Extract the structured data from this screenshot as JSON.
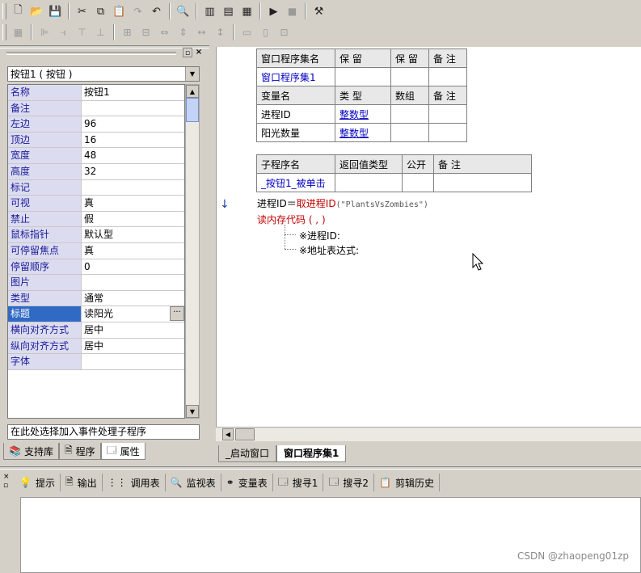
{
  "toolbar1": {
    "icons": [
      "new-file-icon",
      "open-folder-icon",
      "save-icon",
      "cut-icon",
      "copy-icon",
      "paste-icon",
      "redo-icon",
      "undo-icon",
      "find-icon",
      "layout1-icon",
      "layout2-icon",
      "layout3-icon",
      "run-icon",
      "stop-icon",
      "compile-icon"
    ]
  },
  "left_panel": {
    "selected_object": "按钮1 ( 按钮 )",
    "properties": [
      {
        "name": "名称",
        "value": "按钮1"
      },
      {
        "name": "备注",
        "value": ""
      },
      {
        "name": "左边",
        "value": "96"
      },
      {
        "name": "顶边",
        "value": "16"
      },
      {
        "name": "宽度",
        "value": "48"
      },
      {
        "name": "高度",
        "value": "32"
      },
      {
        "name": "标记",
        "value": ""
      },
      {
        "name": "可视",
        "value": "真"
      },
      {
        "name": "禁止",
        "value": "假"
      },
      {
        "name": "鼠标指针",
        "value": "默认型"
      },
      {
        "name": "可停留焦点",
        "value": "真"
      },
      {
        "name": "  停留顺序",
        "value": "0"
      },
      {
        "name": "图片",
        "value": ""
      },
      {
        "name": "类型",
        "value": "通常"
      },
      {
        "name": "标题",
        "value": "读阳光"
      },
      {
        "name": "横向对齐方式",
        "value": "居中"
      },
      {
        "name": "纵向对齐方式",
        "value": "居中"
      },
      {
        "name": "字体",
        "value": ""
      }
    ],
    "ellipsis_label": "···",
    "event_combo": "在此处选择加入事件处理子程序",
    "tabs": [
      "支持库",
      "程序",
      "属性"
    ]
  },
  "editor": {
    "table1": {
      "hdr": [
        "窗口程序集名",
        "保 留",
        "保 留",
        "备 注"
      ],
      "row": [
        "窗口程序集1",
        "",
        "",
        ""
      ],
      "vhdr": [
        "变量名",
        "类 型",
        "数组",
        "备 注"
      ],
      "vars": [
        [
          "进程ID",
          "整数型",
          "",
          ""
        ],
        [
          "阳光数量",
          "整数型",
          "",
          ""
        ]
      ]
    },
    "table2": {
      "hdr": [
        "子程序名",
        "返回值类型",
        "公开",
        "备 注"
      ],
      "row": [
        "_按钮1_被单击",
        "",
        "",
        ""
      ]
    },
    "code1_lhs": "进程ID＝",
    "code1_fn": "取进程ID",
    "code1_arg": "(\"PlantsVsZombies\")",
    "code2": "读内存代码 ( , )",
    "code3": "※进程ID:",
    "code4": "※地址表达式:",
    "arrow": "↓",
    "tabs": [
      "_启动窗口",
      "窗口程序集1"
    ]
  },
  "bottom": {
    "tabs": [
      {
        "icon": "hint-icon",
        "label": "提示"
      },
      {
        "icon": "output-icon",
        "label": "输出"
      },
      {
        "icon": "call-table-icon",
        "label": "调用表"
      },
      {
        "icon": "watch-icon",
        "label": "监视表"
      },
      {
        "icon": "variables-icon",
        "label": "变量表"
      },
      {
        "icon": "search1-icon",
        "label": "搜寻1"
      },
      {
        "icon": "search2-icon",
        "label": "搜寻2"
      },
      {
        "icon": "clipboard-icon",
        "label": "剪辑历史"
      }
    ]
  },
  "watermark": "CSDN @zhaopeng01zp"
}
